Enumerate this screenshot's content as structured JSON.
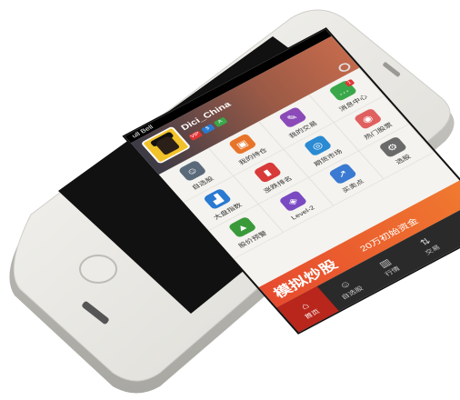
{
  "status": {
    "carrier": "ull Bell"
  },
  "profile": {
    "username": "Dici_China",
    "badges": [
      "VIP",
      "$",
      "A"
    ]
  },
  "grid": [
    {
      "label": "自选股",
      "icon": "person-icon",
      "color": "#5a6a7a",
      "new": ""
    },
    {
      "label": "我的持仓",
      "icon": "portfolio-icon",
      "color": "#e8742a",
      "new": ""
    },
    {
      "label": "我的交易",
      "icon": "trade-icon",
      "color": "#8b4ab8",
      "new": ""
    },
    {
      "label": "消息中心",
      "icon": "chat-icon",
      "color": "#3aa84a",
      "new": "1"
    },
    {
      "label": "大盘指数",
      "icon": "index-chart-icon",
      "color": "#2a7ad2",
      "new": ""
    },
    {
      "label": "涨跌排名",
      "icon": "ranking-icon",
      "color": "#d83a3a",
      "new": ""
    },
    {
      "label": "期货市场",
      "icon": "futures-icon",
      "color": "#2a8ad2",
      "new": ""
    },
    {
      "label": "热门股票",
      "icon": "hot-stock-icon",
      "color": "#e06060",
      "new": ""
    },
    {
      "label": "股价预警",
      "icon": "alert-icon",
      "color": "#3a9a3a",
      "new": ""
    },
    {
      "label": "Level-2",
      "icon": "level2-icon",
      "color": "#7a4ac2",
      "new": ""
    },
    {
      "label": "买卖点",
      "icon": "buysell-icon",
      "color": "#3a7ad2",
      "new": ""
    },
    {
      "label": "选股",
      "icon": "select-stock-icon",
      "color": "#6a6a6a",
      "new": ""
    }
  ],
  "banner": {
    "title": "模拟炒股",
    "subtitle": "20万初始资金"
  },
  "tabs": [
    {
      "label": "首页",
      "icon": "home-icon",
      "glyph": "⌂",
      "active": true
    },
    {
      "label": "自选股",
      "icon": "person-icon",
      "glyph": "☺",
      "active": false
    },
    {
      "label": "行情",
      "icon": "chart-icon",
      "glyph": "▥",
      "active": false
    },
    {
      "label": "交易",
      "icon": "trade-icon",
      "glyph": "⇅",
      "active": false
    },
    {
      "label": "资讯",
      "icon": "news-icon",
      "glyph": "▤",
      "active": false
    }
  ]
}
